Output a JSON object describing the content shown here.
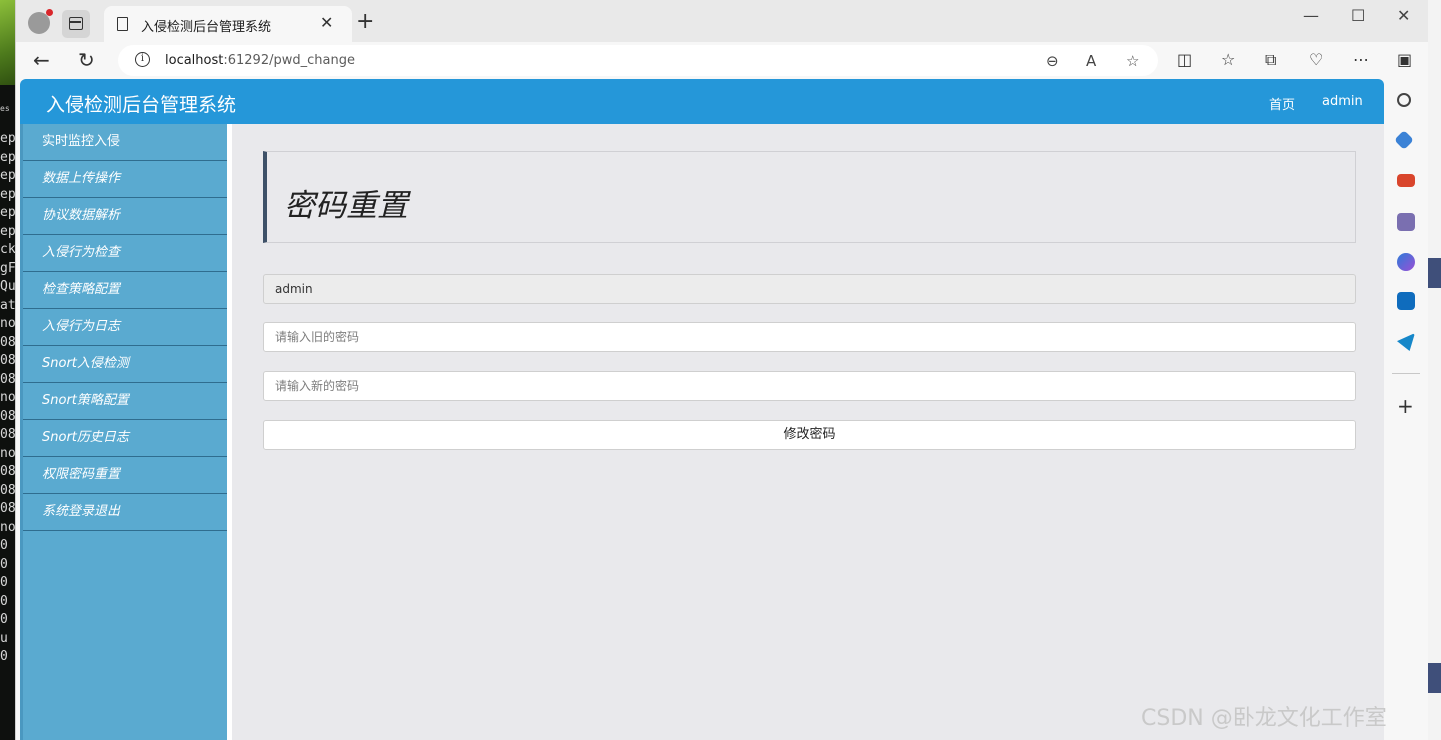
{
  "browser": {
    "tab_title": "入侵检测后台管理系统",
    "url_host": "localhost",
    "url_rest": ":61292/pwd_change",
    "icons": [
      "profile-icon",
      "tab-actions-icon",
      "page-icon",
      "close-icon",
      "new-tab-icon",
      "minimize-icon",
      "maximize-icon",
      "window-close-icon",
      "back-icon",
      "refresh-icon",
      "info-icon",
      "zoom-out-icon",
      "read-aloud-icon",
      "favorite-star-icon",
      "split-screen-icon",
      "favorites-icon",
      "collections-icon",
      "browser-essentials-icon",
      "more-icon",
      "sidebar-toggle-icon"
    ]
  },
  "app": {
    "brand": "入侵检测后台管理系统",
    "nav_home": "首页",
    "nav_user": "admin",
    "header_color": "#2597d9",
    "sidebar_color": "#5aaad0"
  },
  "sidebar": {
    "items": [
      {
        "label": "实时监控入侵"
      },
      {
        "label": "数据上传操作"
      },
      {
        "label": "协议数据解析"
      },
      {
        "label": "入侵行为检查"
      },
      {
        "label": "检查策略配置"
      },
      {
        "label": "入侵行为日志"
      },
      {
        "label": "Snort入侵检测"
      },
      {
        "label": "Snort策略配置"
      },
      {
        "label": "Snort历史日志"
      },
      {
        "label": "权限密码重置"
      },
      {
        "label": "系统登录退出"
      }
    ]
  },
  "form": {
    "title": "密码重置",
    "username_value": "admin",
    "old_password_placeholder": "请输入旧的密码",
    "new_password_placeholder": "请输入新的密码",
    "submit_label": "修改密码"
  },
  "edge_sidebar": {
    "icons": [
      "search-icon",
      "shopping-tag-icon",
      "tools-icon",
      "games-icon",
      "copilot-icon",
      "outlook-icon",
      "send-icon",
      "add-icon"
    ]
  },
  "background": {
    "terminal_top": "es (",
    "terminal_lines": [
      "ep",
      "ep",
      "ep",
      "ep",
      "ep",
      "ep",
      "ck",
      "gF",
      "Qu",
      "at",
      "no",
      "08",
      "08",
      "08",
      "no",
      "08",
      "08",
      "no",
      "08",
      "08",
      "08",
      "no",
      "0",
      "0",
      "0",
      "0",
      "0",
      "u",
      "0"
    ],
    "watermark": "CSDN @卧龙文化工作室"
  }
}
